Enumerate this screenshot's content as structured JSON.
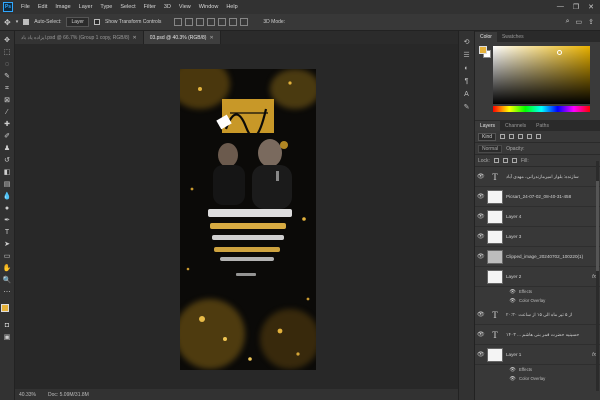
{
  "menubar": {
    "logo": "Ps",
    "items": [
      "File",
      "Edit",
      "Image",
      "Layer",
      "Type",
      "Select",
      "Filter",
      "3D",
      "View",
      "Window",
      "Help"
    ],
    "window_controls": [
      "—",
      "❐",
      "✕"
    ]
  },
  "options_bar": {
    "auto_select_label": "Auto-Select:",
    "auto_select_target": "Layer",
    "show_transform_label": "Show Transform Controls",
    "mode_3d_label": "3D Mode:"
  },
  "tabs": [
    {
      "label": "ایزاده یاد باد.psd @ 66.7% (Group 1 copy, RGB/8)",
      "close": "✕",
      "active": false
    },
    {
      "label": "03.psd @ 40.3% (RGB/8)",
      "close": "✕",
      "active": true
    }
  ],
  "status_bar": {
    "zoom": "40.33%",
    "doc_size": "Doc: 5.09M/31.8M"
  },
  "color_panel": {
    "tabs": [
      "Color",
      "Swatches"
    ],
    "foreground": "#e6b23a",
    "background": "#ffffff"
  },
  "layers_panel": {
    "tabs": [
      "Layers",
      "Channels",
      "Paths"
    ],
    "kind_label": "Kind",
    "blend_mode": "Normal",
    "opacity_label": "Opacity:",
    "lock_label": "Lock:",
    "fill_label": "Fill:",
    "layers": [
      {
        "name": "سازنده: بلوار امیرمازندرانی، مهدی آباد",
        "kind": "text",
        "fx": ""
      },
      {
        "name": "Picsart_24-07-02_08-40-31-458",
        "kind": "image",
        "fx": ""
      },
      {
        "name": "Layer 4",
        "kind": "image",
        "fx": ""
      },
      {
        "name": "Layer 3",
        "kind": "image",
        "fx": ""
      },
      {
        "name": "Clipped_image_20240702_100220(1)",
        "kind": "photo",
        "fx": ""
      },
      {
        "name": "Layer 2",
        "kind": "image",
        "fx": "fx"
      },
      {
        "name": "از ۵ تیر ماه الی ۱۵ از ساعت ۲۰:۳۰",
        "kind": "text",
        "fx": ""
      },
      {
        "name": "حسینیه حضرت قمر بنی هاشم ... ۱۴۰۳",
        "kind": "text",
        "fx": ""
      },
      {
        "name": "Layer 1",
        "kind": "image",
        "fx": "fx"
      }
    ],
    "effects_label": "Effects",
    "color_overlay_label": "Color Overlay",
    "bottom_icons": [
      "⛓",
      "fx",
      "◐",
      "▭",
      "▢",
      "🗑"
    ]
  }
}
